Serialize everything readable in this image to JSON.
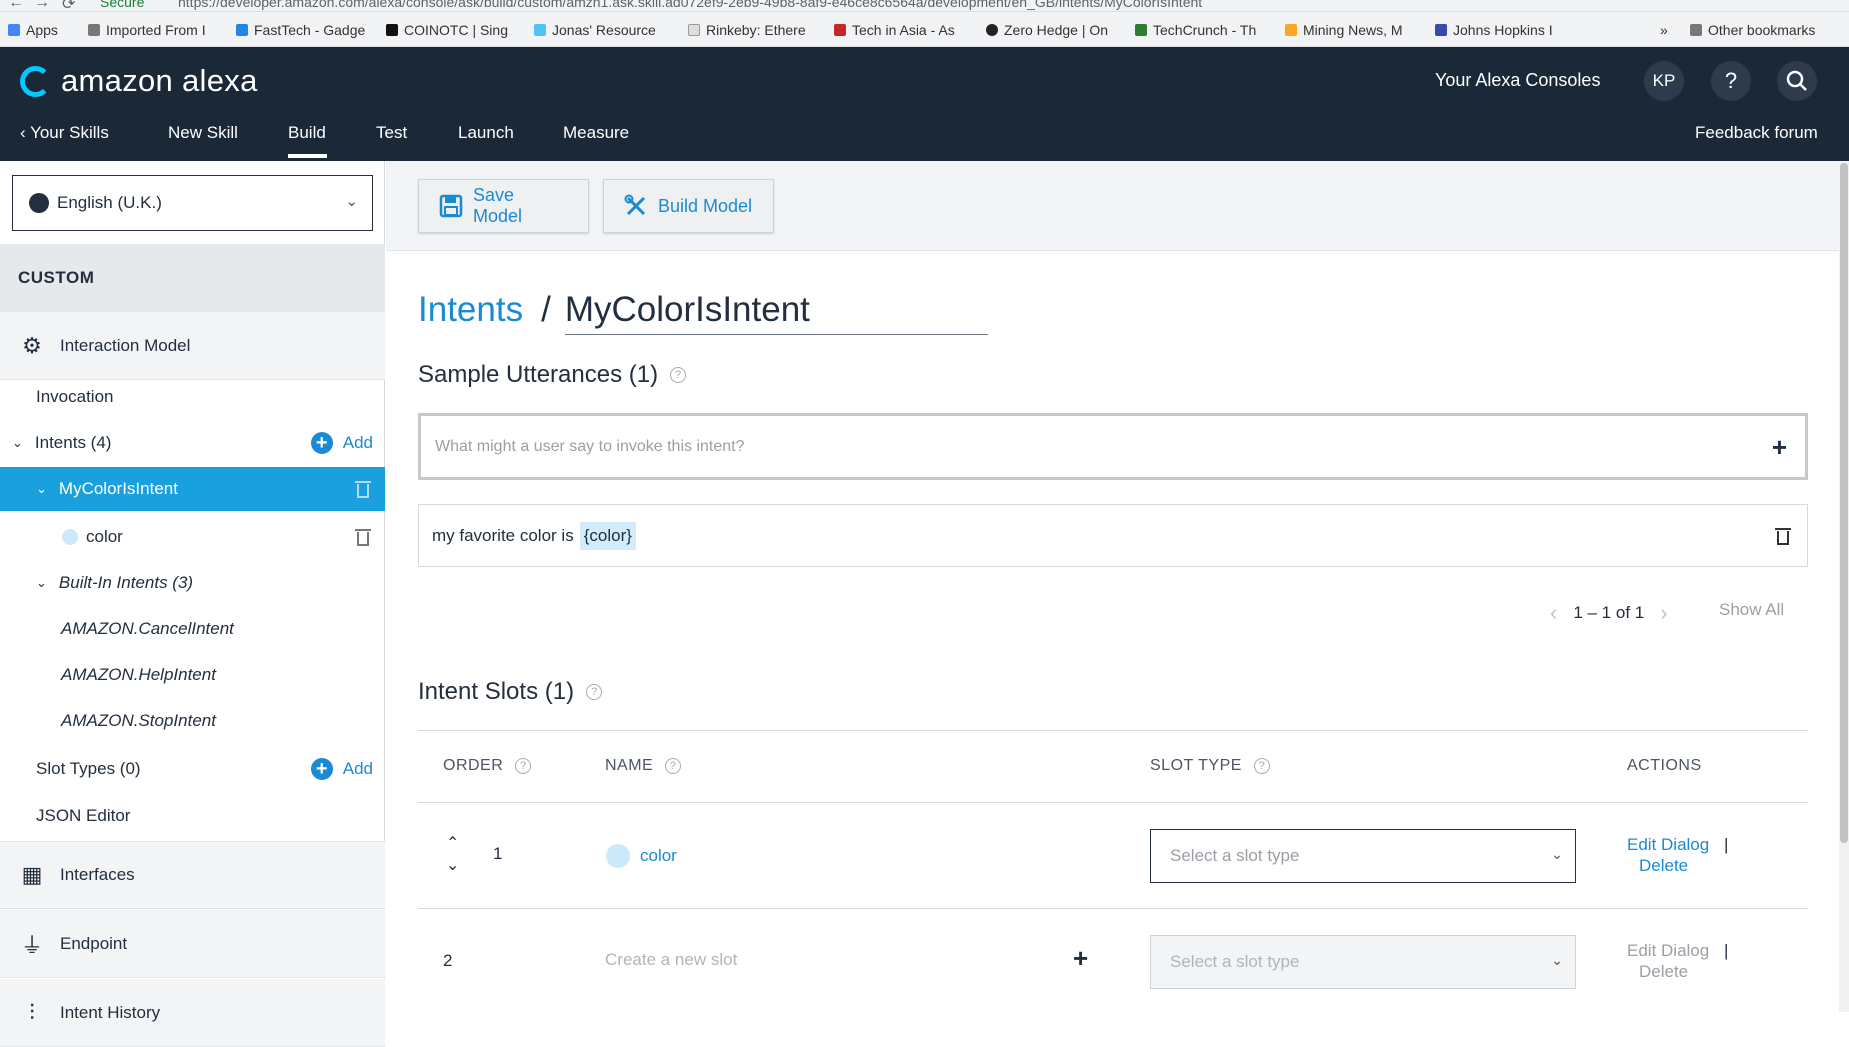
{
  "browser": {
    "secure_label": "Secure",
    "url": "https://developer.amazon.com/alexa/console/ask/build/custom/amzn1.ask.skill.ad072ef9-2eb9-49b8-8af9-e46ce8c6564a/development/en_GB/intents/MyColorIsIntent",
    "bookmarks": [
      "Apps",
      "Imported From I",
      "FastTech - Gadge",
      "COINOTC | Sing",
      "Jonas' Resource",
      "Rinkeby: Ethere",
      "Tech in Asia - As",
      "Zero Hedge | On",
      "TechCrunch - Th",
      "Mining News, M",
      "Johns Hopkins I"
    ],
    "overflow": "»",
    "other_bookmarks": "Other bookmarks"
  },
  "header": {
    "brand": "amazon alexa",
    "consoles": "Your Alexa Consoles",
    "avatar_initials": "KP",
    "help": "?",
    "nav": [
      "Your Skills",
      "New Skill",
      "Build",
      "Test",
      "Launch",
      "Measure"
    ],
    "active_nav": "Build",
    "feedback": "Feedback forum"
  },
  "sidebar": {
    "language": "English (U.K.)",
    "custom_label": "CUSTOM",
    "interaction_model": "Interaction Model",
    "invocation": "Invocation",
    "intents": "Intents (4)",
    "add_label": "Add",
    "active_intent": "MyColorIsIntent",
    "slot": "color",
    "builtin": "Built-In Intents (3)",
    "builtin_items": [
      "AMAZON.CancelIntent",
      "AMAZON.HelpIntent",
      "AMAZON.StopIntent"
    ],
    "slot_types": "Slot Types (0)",
    "json_editor": "JSON Editor",
    "interfaces": "Interfaces",
    "endpoint": "Endpoint",
    "intent_history": "Intent History"
  },
  "toolbar": {
    "save": "Save Model",
    "build": "Build Model"
  },
  "main": {
    "breadcrumb_parent": "Intents",
    "breadcrumb_sep": "/",
    "breadcrumb_current": "MyColorIsIntent",
    "utterances_title": "Sample Utterances (1)",
    "utterance_placeholder": "What might a user say to invoke this intent?",
    "utterance_text": "my favorite color is",
    "utterance_slot": "{color}",
    "pager_range": "1 – 1 of 1",
    "show_all": "Show All",
    "slots_title": "Intent Slots (1)",
    "columns": [
      "ORDER",
      "NAME",
      "SLOT TYPE",
      "ACTIONS"
    ],
    "rows": [
      {
        "order": "1",
        "name": "color",
        "slot_type_placeholder": "Select a slot type",
        "edit": "Edit Dialog",
        "sep": "|",
        "delete": "Delete"
      },
      {
        "order": "2",
        "name_placeholder": "Create a new slot",
        "slot_type_placeholder": "Select a slot type",
        "edit": "Edit Dialog",
        "sep": "|",
        "delete": "Delete"
      }
    ]
  },
  "colors": {
    "header_bg": "#1b2838",
    "accent": "#1a8ad4",
    "active_item": "#1aa0de",
    "alexa_ring": "#00caff"
  }
}
